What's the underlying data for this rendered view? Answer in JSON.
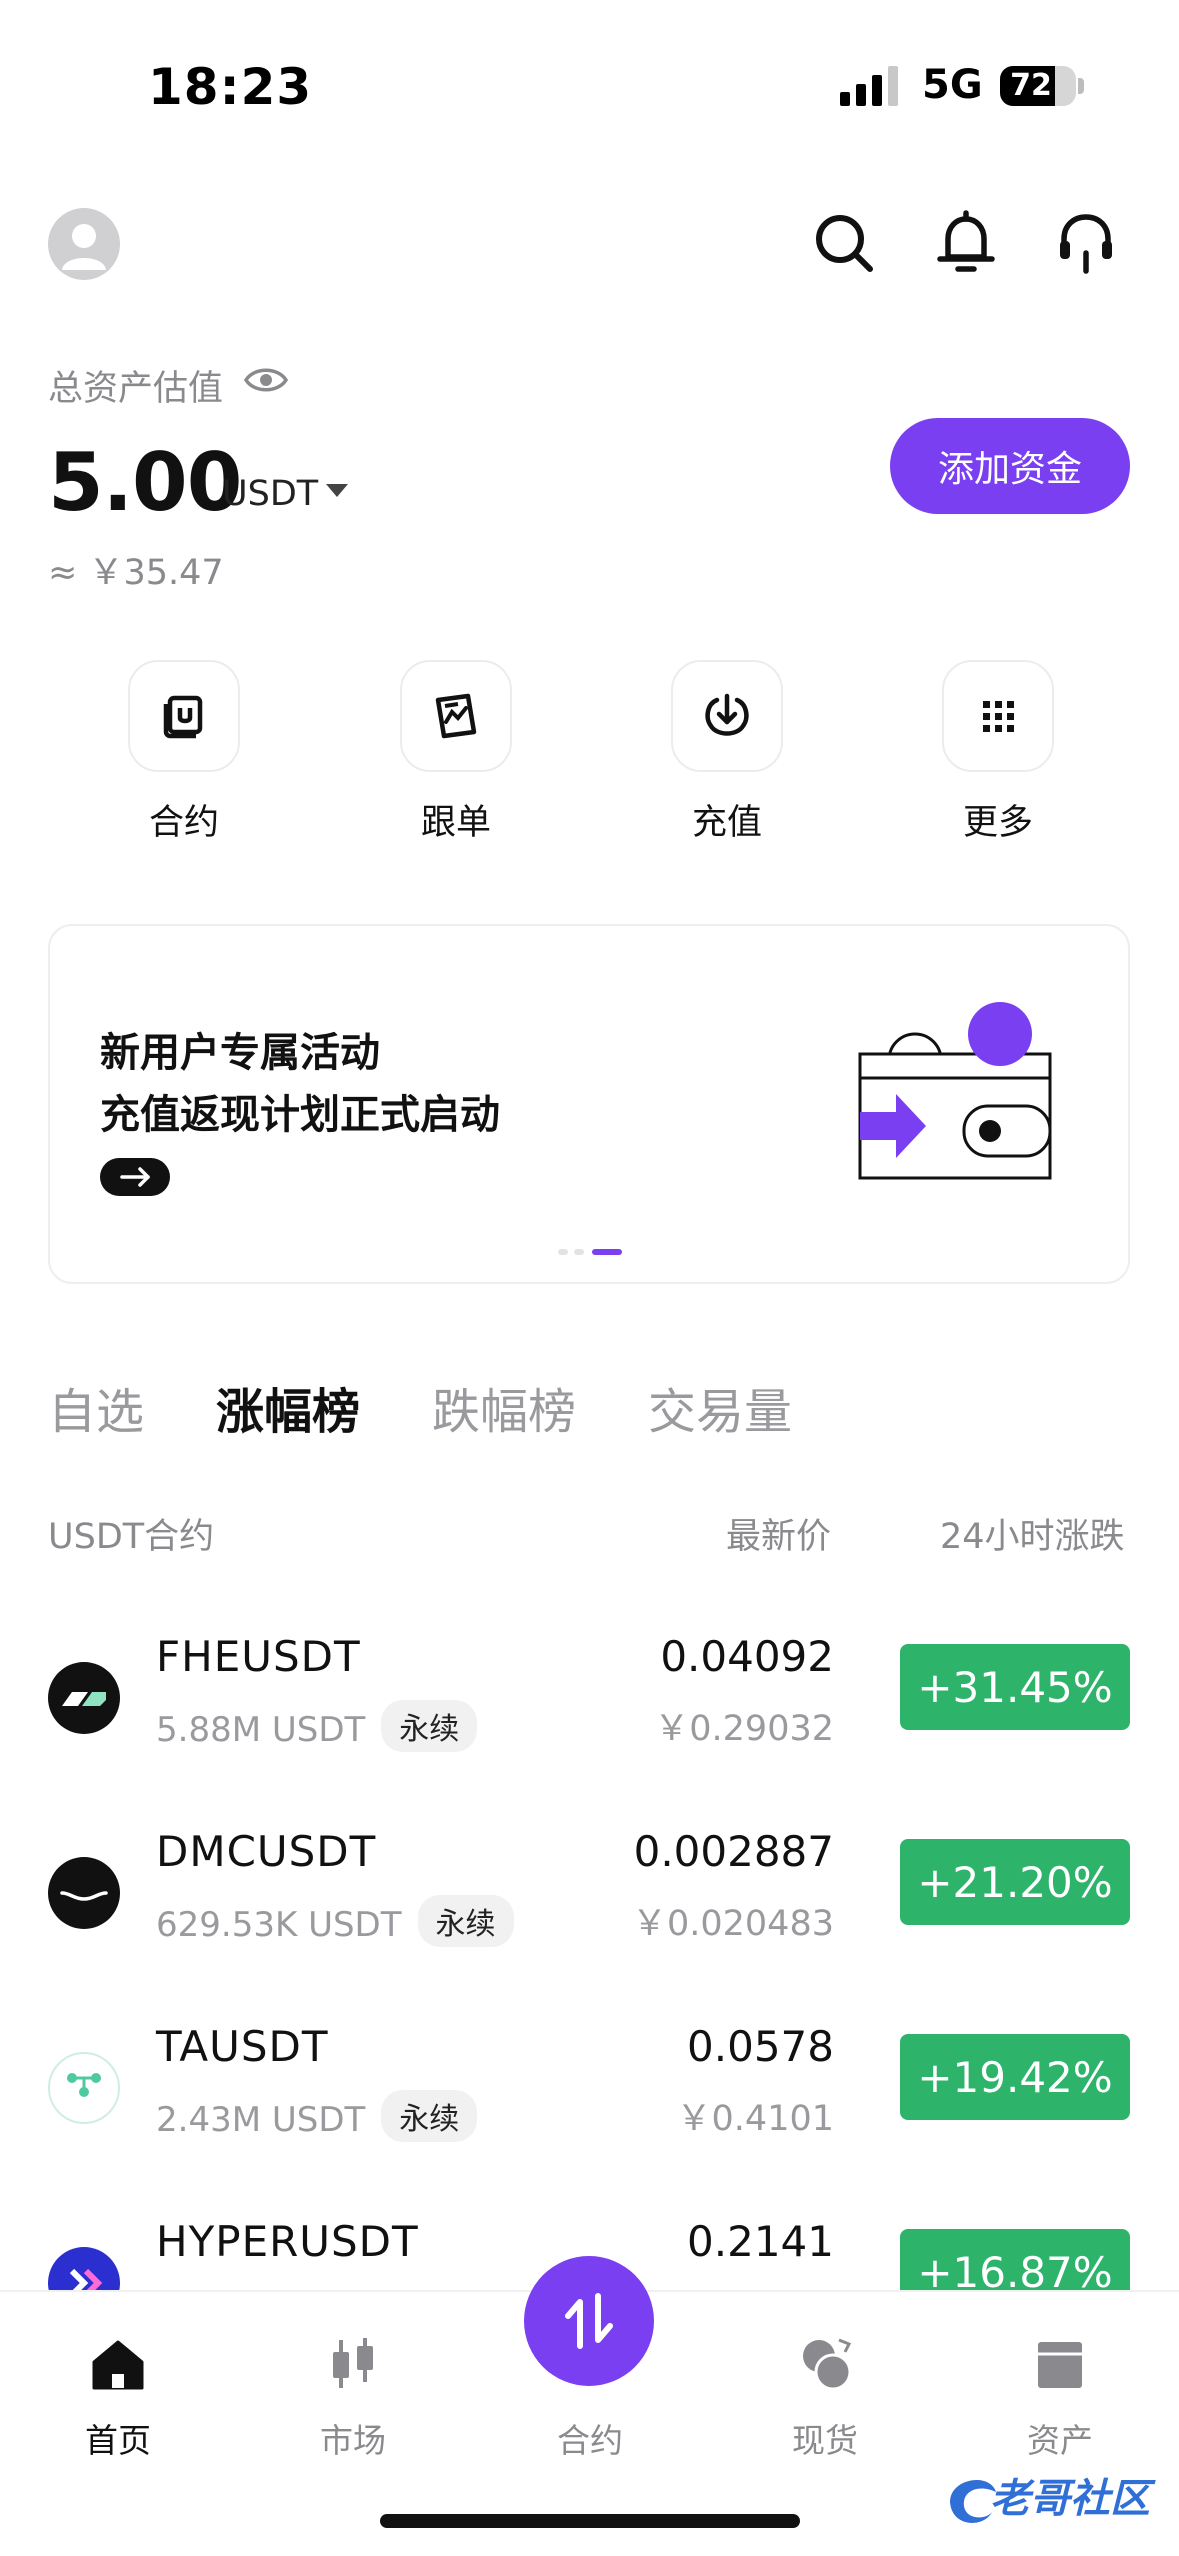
{
  "status": {
    "time": "18:23",
    "network": "5G",
    "battery": "72",
    "battery_level": 0.72
  },
  "header": {
    "avatar": "avatar",
    "search_icon": "search-icon",
    "bell_icon": "bell-icon",
    "support_icon": "headset-icon"
  },
  "asset": {
    "label": "总资产估值",
    "value": "5.00",
    "unit": "USDT",
    "cny": "≈ ￥35.47",
    "add_funds": "添加资金"
  },
  "quick_actions": [
    {
      "label": "合约",
      "icon": "contract-icon"
    },
    {
      "label": "跟单",
      "icon": "copy-trade-icon"
    },
    {
      "label": "充值",
      "icon": "deposit-icon"
    },
    {
      "label": "更多",
      "icon": "grid-icon"
    }
  ],
  "banner": {
    "line1": "新用户专属活动",
    "line2": "充值返现计划正式启动",
    "accent": "#7a3ff0"
  },
  "tabs": [
    "自选",
    "涨幅榜",
    "跌幅榜",
    "交易量"
  ],
  "active_tab": "涨幅榜",
  "columns": {
    "pair": "USDT合约",
    "price": "最新价",
    "change": "24小时涨跌"
  },
  "rows": [
    {
      "symbol": "FHEUSDT",
      "volume": "5.88M USDT",
      "tag": "永续",
      "price": "0.04092",
      "price_cny": "￥0.29032",
      "change": "+31.45%"
    },
    {
      "symbol": "DMCUSDT",
      "volume": "629.53K USDT",
      "tag": "永续",
      "price": "0.002887",
      "price_cny": "￥0.020483",
      "change": "+21.20%"
    },
    {
      "symbol": "TAUSDT",
      "volume": "2.43M USDT",
      "tag": "永续",
      "price": "0.0578",
      "price_cny": "￥0.4101",
      "change": "+19.42%"
    },
    {
      "symbol": "HYPERUSDT",
      "volume": "",
      "tag": "",
      "price": "0.2141",
      "price_cny": "",
      "change": "+16.87%"
    }
  ],
  "nav": [
    {
      "label": "首页",
      "icon": "home-icon"
    },
    {
      "label": "市场",
      "icon": "market-icon"
    },
    {
      "label": "合约",
      "icon": "swap-icon"
    },
    {
      "label": "现货",
      "icon": "spot-icon"
    },
    {
      "label": "资产",
      "icon": "wallet-icon"
    }
  ],
  "watermark": "老哥社区",
  "colors": {
    "accent": "#7a3ff0",
    "up": "#2eb36b"
  }
}
